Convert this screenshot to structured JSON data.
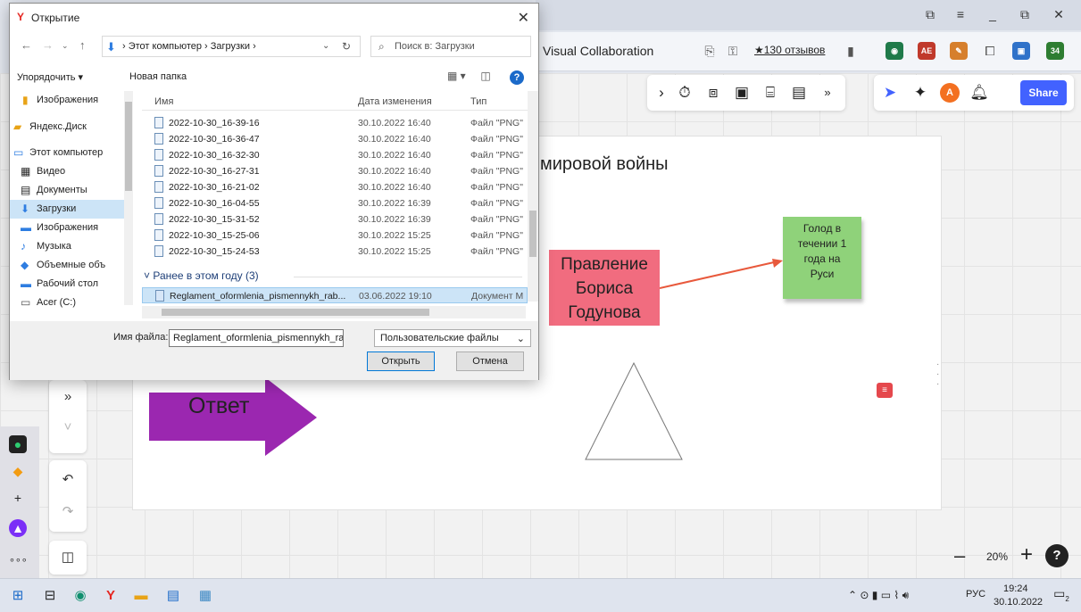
{
  "browser": {
    "site_title": "Visual Collaboration",
    "reviews": "★130 отзывов",
    "ext_badges": [
      "AE",
      "34"
    ]
  },
  "board": {
    "frame_title": "мировой войны",
    "card_orange": [
      "Правление",
      "Бориса",
      "Годунова"
    ],
    "sticky_green": [
      "Голод в",
      "течении 1",
      "года на",
      "Руси"
    ],
    "arrow_text": "Ответ",
    "share": "Share",
    "avatar": "A",
    "zoom": "20%"
  },
  "dialog": {
    "title": "Открытие",
    "path": "› Этот компьютер › Загрузки ›",
    "search_placeholder": "Поиск в: Загрузки",
    "organize": "Упорядочить ▾",
    "new_folder": "Новая папка",
    "nav_items": [
      {
        "label": "Изображения",
        "icon": "folder-yellow-icon"
      },
      {
        "label": "Яндекс.Диск",
        "icon": "yandex-disk-icon"
      },
      {
        "label": "Этот компьютер",
        "icon": "computer-icon"
      },
      {
        "label": "Видео",
        "icon": "video-icon"
      },
      {
        "label": "Документы",
        "icon": "documents-icon"
      },
      {
        "label": "Загрузки",
        "icon": "downloads-icon"
      },
      {
        "label": "Изображения",
        "icon": "pictures-icon"
      },
      {
        "label": "Музыка",
        "icon": "music-icon"
      },
      {
        "label": "Объемные объ",
        "icon": "3d-objects-icon"
      },
      {
        "label": "Рабочий стол",
        "icon": "desktop-icon"
      },
      {
        "label": "Acer (C:)",
        "icon": "drive-icon"
      }
    ],
    "columns": {
      "name": "Имя",
      "date": "Дата изменения",
      "type": "Тип"
    },
    "files": [
      {
        "name": "2022-10-30_16-39-16",
        "date": "30.10.2022 16:40",
        "type": "Файл \"PNG\""
      },
      {
        "name": "2022-10-30_16-36-47",
        "date": "30.10.2022 16:40",
        "type": "Файл \"PNG\""
      },
      {
        "name": "2022-10-30_16-32-30",
        "date": "30.10.2022 16:40",
        "type": "Файл \"PNG\""
      },
      {
        "name": "2022-10-30_16-27-31",
        "date": "30.10.2022 16:40",
        "type": "Файл \"PNG\""
      },
      {
        "name": "2022-10-30_16-21-02",
        "date": "30.10.2022 16:40",
        "type": "Файл \"PNG\""
      },
      {
        "name": "2022-10-30_16-04-55",
        "date": "30.10.2022 16:39",
        "type": "Файл \"PNG\""
      },
      {
        "name": "2022-10-30_15-31-52",
        "date": "30.10.2022 16:39",
        "type": "Файл \"PNG\""
      },
      {
        "name": "2022-10-30_15-25-06",
        "date": "30.10.2022 15:25",
        "type": "Файл \"PNG\""
      },
      {
        "name": "2022-10-30_15-24-53",
        "date": "30.10.2022 15:25",
        "type": "Файл \"PNG\""
      }
    ],
    "group_label": "Ранее в этом году (3)",
    "selected_file": {
      "name": "Reglament_oformlenia_pismennykh_rab...",
      "date": "03.06.2022 19:10",
      "type": "Документ M"
    },
    "filename_label": "Имя файла:",
    "filename_value": "Reglament_oformlenia_pismennykh_rabot_",
    "filetype": "Пользовательские файлы",
    "open_btn": "Открыть",
    "cancel_btn": "Отмена"
  },
  "taskbar": {
    "lang": "РУС",
    "time": "19:24",
    "date": "30.10.2022",
    "notif_count": "2"
  }
}
